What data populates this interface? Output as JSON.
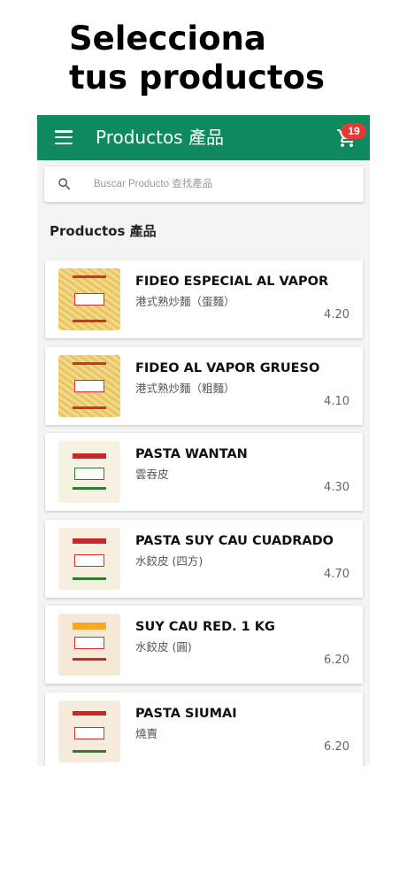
{
  "promo": {
    "line1": "Selecciona",
    "line2": "tus productos"
  },
  "appbar": {
    "title": "Productos 產品",
    "cart_count": "19"
  },
  "search": {
    "placeholder": "Buscar Producto 查找產品"
  },
  "section_title": "Productos 產品",
  "colors": {
    "appbar": "#0f8a5f",
    "badge": "#e53935"
  },
  "products": [
    {
      "name": "FIDEO ESPECIAL AL VAPOR",
      "subname": "港式熟炒麵（蛋麵）",
      "price": "4.20",
      "image": "noodle-pack"
    },
    {
      "name": "FIDEO AL VAPOR GRUESO",
      "subname": "港式熟炒麵（粗麵）",
      "price": "4.10",
      "image": "noodle-pack"
    },
    {
      "name": "PASTA WANTAN",
      "subname": "雲吞皮",
      "price": "4.30",
      "image": "wrapper-pack"
    },
    {
      "name": "PASTA SUY CAU CUADRADO",
      "subname": "水餃皮 (四方)",
      "price": "4.70",
      "image": "wrapper-pack"
    },
    {
      "name": "SUY CAU RED. 1 KG",
      "subname": "水餃皮 (圓)",
      "price": "6.20",
      "image": "wrapper-pack"
    },
    {
      "name": "PASTA SIUMAI",
      "subname": "燒賣",
      "price": "6.20",
      "image": "wrapper-pack"
    }
  ]
}
